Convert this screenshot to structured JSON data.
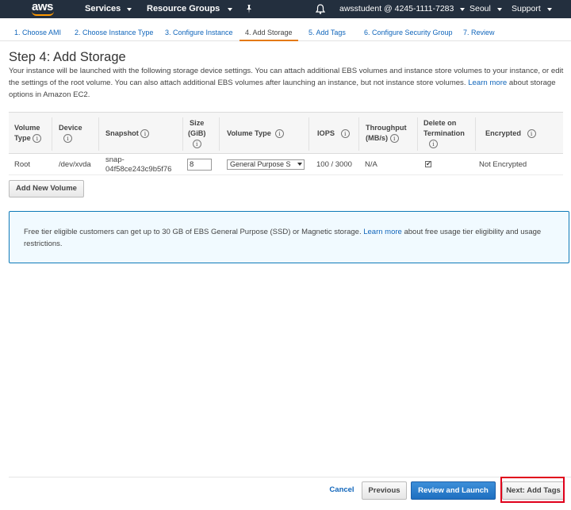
{
  "topnav": {
    "logo": "aws",
    "services": "Services",
    "resource_groups": "Resource Groups",
    "account": "awsstudent @ 4245-1111-7283",
    "region": "Seoul",
    "support": "Support"
  },
  "tabs": [
    {
      "label": "1. Choose AMI"
    },
    {
      "label": "2. Choose Instance Type"
    },
    {
      "label": "3. Configure Instance"
    },
    {
      "label": "4. Add Storage"
    },
    {
      "label": "5. Add Tags"
    },
    {
      "label": "6. Configure Security Group"
    },
    {
      "label": "7. Review"
    }
  ],
  "page": {
    "title": "Step 4: Add Storage",
    "desc_1": "Your instance will be launched with the following storage device settings. You can attach additional EBS volumes and instance store volumes to your instance, or edit the settings of the root volume. You can also attach additional EBS volumes after launching an instance, but not instance store volumes.",
    "desc_link": "Learn more",
    "desc_2": "about storage options in Amazon EC2."
  },
  "table": {
    "headers": {
      "volume_type_1": "Volume",
      "volume_type_2": "Type",
      "device": "Device",
      "snapshot": "Snapshot",
      "size_1": "Size",
      "size_2": "(GiB)",
      "vol_type": "Volume Type",
      "iops": "IOPS",
      "throughput_1": "Throughput",
      "throughput_2": "(MB/s)",
      "delete_1": "Delete on",
      "delete_2": "Termination",
      "encrypted": "Encrypted"
    },
    "row": {
      "volume_type": "Root",
      "device": "/dev/xvda",
      "snapshot_1": "snap-",
      "snapshot_2": "04f58ce243c9b5f76",
      "size": "8",
      "vol_type": "General Purpose S",
      "iops": "100 / 3000",
      "throughput": "N/A",
      "delete_checked": "✔",
      "encrypted": "Not Encrypted"
    }
  },
  "add_volume_label": "Add New Volume",
  "info": {
    "text_1": "Free tier eligible customers can get up to 30 GB of EBS General Purpose (SSD) or Magnetic storage.",
    "link": "Learn more",
    "text_2": "about free usage tier eligibility and usage restrictions."
  },
  "footer": {
    "cancel": "Cancel",
    "previous": "Previous",
    "review": "Review and Launch",
    "next": "Next: Add Tags"
  },
  "colors": {
    "nav_bg": "#232f3e",
    "accent": "#ff9900",
    "link": "#1166bb",
    "primary_button": "#1e6fc0",
    "highlight": "#e0001b"
  }
}
